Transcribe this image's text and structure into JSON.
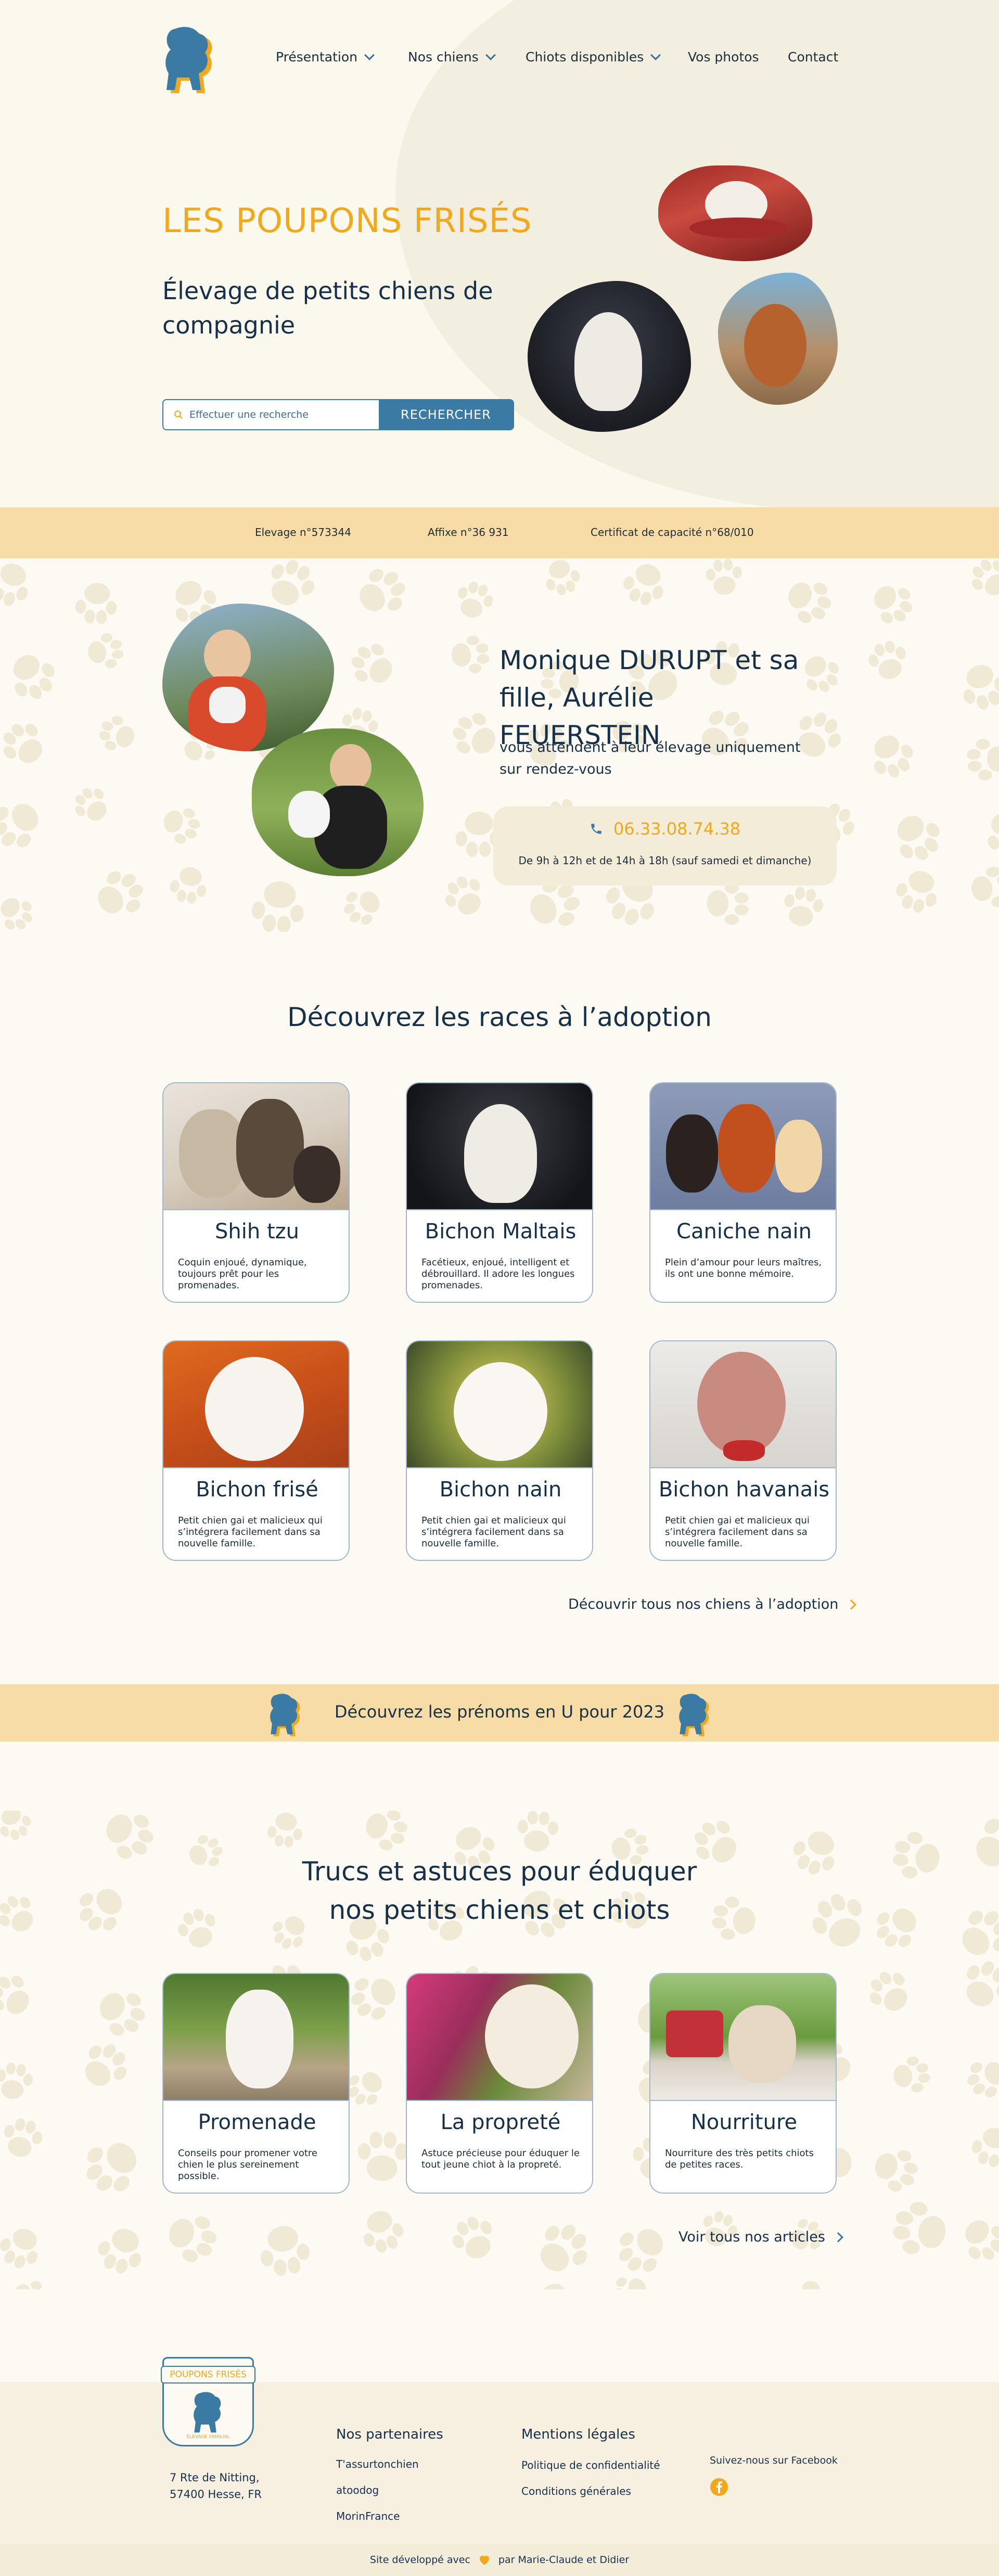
{
  "nav": {
    "items": [
      {
        "label": "Présentation",
        "has_dropdown": true
      },
      {
        "label": "Nos chiens",
        "has_dropdown": true
      },
      {
        "label": "Chiots disponibles",
        "has_dropdown": true
      },
      {
        "label": "Vos photos",
        "has_dropdown": false
      },
      {
        "label": "Contact",
        "has_dropdown": false
      }
    ]
  },
  "hero": {
    "title": "LES POUPONS FRISÉS",
    "subtitle": "Élevage de petits chiens de compagnie",
    "search_placeholder": "Effectuer une recherche",
    "search_button": "RECHERCHER"
  },
  "credentials": {
    "items": [
      "Elevage n°573344",
      "Affixe n°36 931",
      "Certificat de capacité n°68/010"
    ]
  },
  "owners": {
    "title": "Monique DURUPT et sa fille, Aurélie FEUERSTEIN",
    "text": "vous attendent à leur élevage uniquement sur rendez-vous",
    "phone": "06.33.08.74.38",
    "hours": "De 9h à 12h et de 14h à 18h (sauf samedi et dimanche)"
  },
  "breeds": {
    "title": "Découvrez les races à l’adoption",
    "cards": [
      {
        "name": "Shih tzu",
        "desc": "Coquin enjoué, dynamique, toujours prêt pour les promenades."
      },
      {
        "name": "Bichon Maltais",
        "desc": "Facétieux, enjoué, intelligent et débrouillard. Il adore les longues promenades."
      },
      {
        "name": "Caniche nain",
        "desc": "Plein d’amour pour leurs maîtres, ils ont une bonne mémoire."
      },
      {
        "name": "Bichon frisé",
        "desc": "Petit chien gai et malicieux qui s’intégrera facilement dans sa nouvelle famille."
      },
      {
        "name": "Bichon nain",
        "desc": "Petit chien gai et malicieux qui s’intégrera facilement dans sa nouvelle famille."
      },
      {
        "name": "Bichon havanais",
        "desc": "Petit chien gai et malicieux qui s’intégrera facilement dans sa nouvelle famille."
      }
    ],
    "more_link": "Découvrir tous nos chiens à l’adoption"
  },
  "names_banner": {
    "text": "Découvrez les prénoms en U pour 2023"
  },
  "tips": {
    "title_line1": "Trucs et astuces pour éduquer",
    "title_line2": "nos petits chiens et chiots",
    "cards": [
      {
        "name": "Promenade",
        "desc": "Conseils pour promener votre chien le plus sereinement possible."
      },
      {
        "name": "La propreté",
        "desc": "Astuce précieuse pour éduquer le tout jeune chiot à la propreté."
      },
      {
        "name": "Nourriture",
        "desc": "Nourriture des très petits chiots de petites races."
      }
    ],
    "more_link": "Voir tous nos articles"
  },
  "footer": {
    "badge_text": "POUPONS FRISÉS",
    "badge_sub": "ÉLEVAGE FAMILIAL",
    "address_line1": "7 Rte de Nitting,",
    "address_line2": "57400 Hesse, FR",
    "partners_title": "Nos partenaires",
    "partners": [
      "T'assurtonchien",
      "atoodog",
      "MorinFrance"
    ],
    "legal_title": "Mentions légales",
    "legal": [
      "Politique de confidentialité",
      "Conditions générales"
    ],
    "facebook": "Suivez-nous sur Facebook",
    "credit_left": "Site développé avec",
    "credit_right": "par Marie-Claude et Didier"
  },
  "colors": {
    "accent": "#f2a81d",
    "blue": "#3a7aa3",
    "navy": "#17304a",
    "cream": "#fcfaf2",
    "band": "#f7dca5"
  }
}
